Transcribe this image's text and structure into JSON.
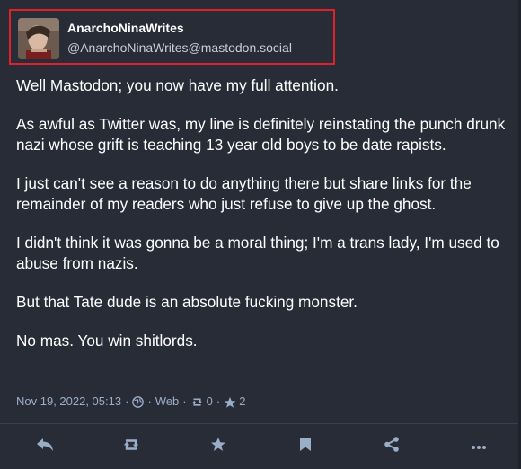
{
  "author": {
    "display_name": "AnarchoNinaWrites",
    "account": "@AnarchoNinaWrites@mastodon.social"
  },
  "content": {
    "paragraphs": [
      "Well Mastodon; you now have my full attention.",
      "As awful as Twitter was, my line is definitely reinstating the punch drunk nazi whose grift is teaching 13 year old boys to be date rapists.",
      "I just can't see a reason to do anything there but share links for the remainder of my readers who just refuse to give up the ghost.",
      "I didn't think it was gonna be a moral thing; I'm a trans lady, I'm used to abuse from nazis.",
      "But that Tate dude is an absolute fucking monster.",
      "No mas. You win shitlords."
    ]
  },
  "meta": {
    "timestamp": "Nov 19, 2022, 05:13",
    "visibility_icon": "globe-icon",
    "separator": "·",
    "client": "Web",
    "boost_count": "0",
    "favourite_count": "2"
  },
  "actions": {
    "icons": [
      "reply-icon",
      "boost-icon",
      "favourite-icon",
      "bookmark-icon",
      "share-icon",
      "more-icon"
    ]
  },
  "colors": {
    "background": "#282c37",
    "text": "#ffffff",
    "muted": "#9baec8",
    "highlight_border": "#e0202a"
  }
}
